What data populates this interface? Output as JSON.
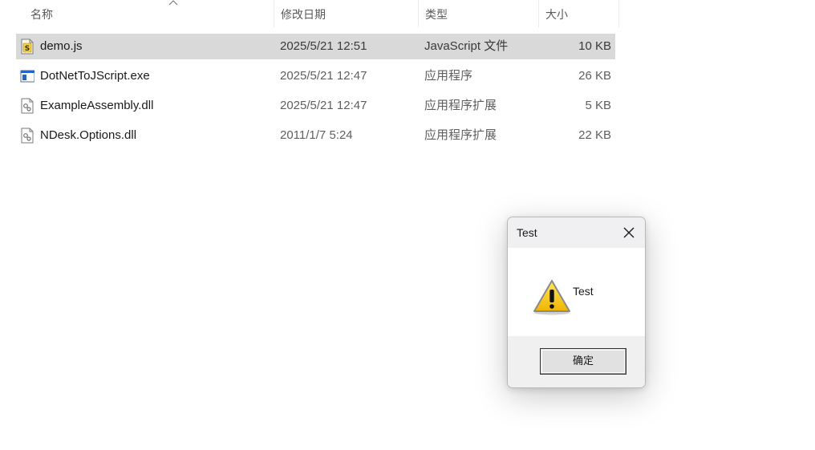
{
  "explorer": {
    "columns": {
      "name": "名称",
      "date": "修改日期",
      "type": "类型",
      "size": "大小"
    },
    "files": [
      {
        "name": "demo.js",
        "date": "2025/5/21 12:51",
        "type": "JavaScript 文件",
        "size": "10 KB",
        "icon": "javascript-file-icon",
        "selected": true
      },
      {
        "name": "DotNetToJScript.exe",
        "date": "2025/5/21 12:47",
        "type": "应用程序",
        "size": "26 KB",
        "icon": "application-icon",
        "selected": false
      },
      {
        "name": "ExampleAssembly.dll",
        "date": "2025/5/21 12:47",
        "type": "应用程序扩展",
        "size": "5 KB",
        "icon": "dll-file-icon",
        "selected": false
      },
      {
        "name": "NDesk.Options.dll",
        "date": "2011/1/7 5:24",
        "type": "应用程序扩展",
        "size": "22 KB",
        "icon": "dll-file-icon",
        "selected": false
      }
    ]
  },
  "dialog": {
    "title": "Test",
    "message": "Test",
    "ok_label": "确定",
    "icon": "warning-icon",
    "close_icon": "close-icon"
  },
  "colors": {
    "selection": "#d9d9d9",
    "titlebar": "#f0f0f3",
    "footer": "#f0f0f0",
    "warning_yellow": "#f5c400"
  }
}
